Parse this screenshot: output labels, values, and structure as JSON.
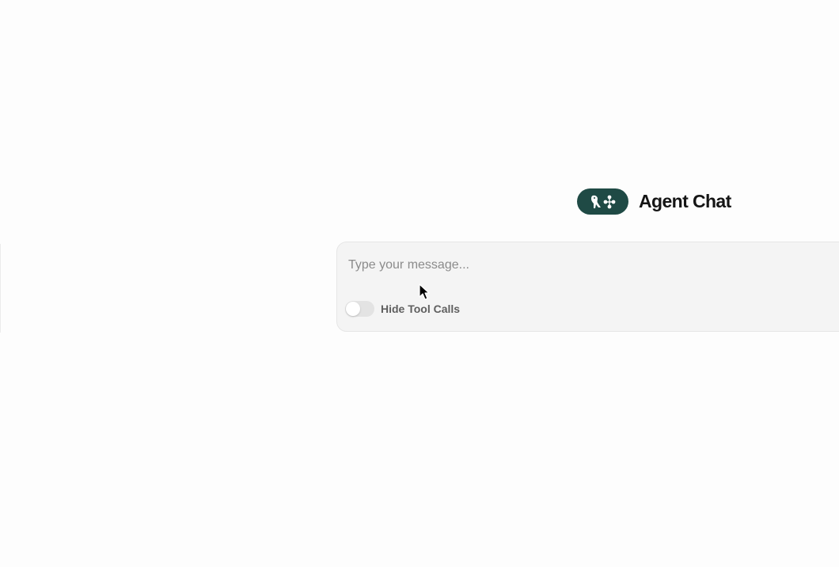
{
  "header": {
    "title": "Agent Chat",
    "logo_icon": "parrot-network-logo",
    "logo_color": "#1f4a45"
  },
  "composer": {
    "message_value": "",
    "message_placeholder": "Type your message...",
    "toggle_label": "Hide Tool Calls",
    "toggle_on": false
  },
  "colors": {
    "background": "#fdfdfd",
    "composer_bg": "#f4f4f4",
    "toggle_off": "#e3e3e3"
  }
}
